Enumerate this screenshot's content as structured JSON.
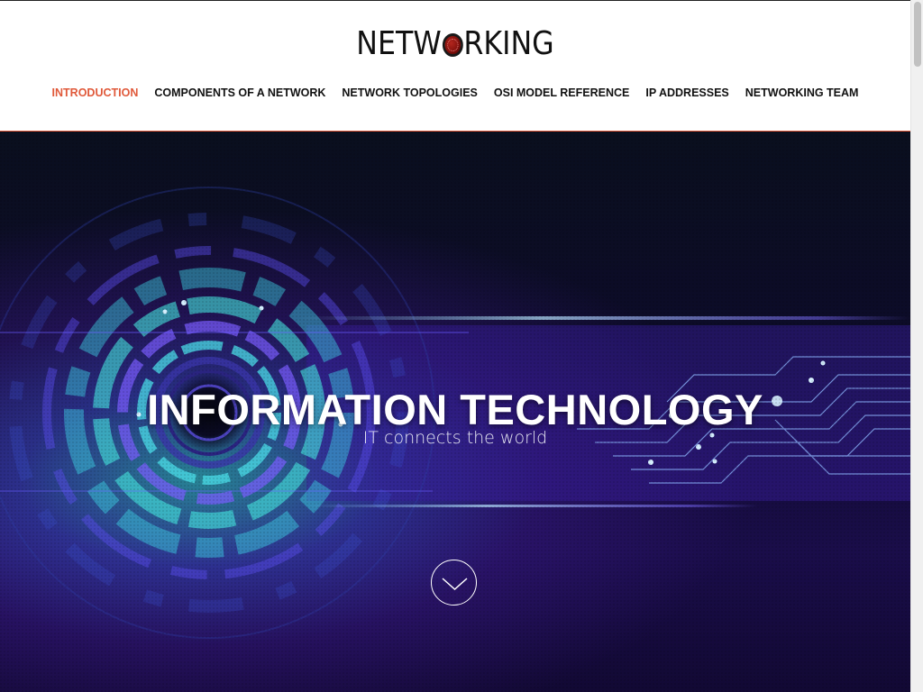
{
  "header": {
    "logo_before": "NETW",
    "logo_after": "RKING"
  },
  "nav": {
    "items": [
      {
        "label": "INTRODUCTION",
        "active": true
      },
      {
        "label": "COMPONENTS OF A NETWORK",
        "active": false
      },
      {
        "label": "NETWORK TOPOLOGIES",
        "active": false
      },
      {
        "label": "OSI MODEL REFERENCE",
        "active": false
      },
      {
        "label": "IP ADDRESSES",
        "active": false
      },
      {
        "label": "NETWORKING TEAM",
        "active": false
      }
    ]
  },
  "hero": {
    "title": "INFORMATION TECHNOLOGY",
    "subtitle": "IT connects the world",
    "scroll_icon": "chevron-down-icon"
  },
  "colors": {
    "accent": "#e0593a",
    "nav_text": "#111111",
    "hero_bg": "#0d0b2a",
    "hero_glow": "#37e6dc",
    "hero_purple": "#5a2fc9"
  }
}
